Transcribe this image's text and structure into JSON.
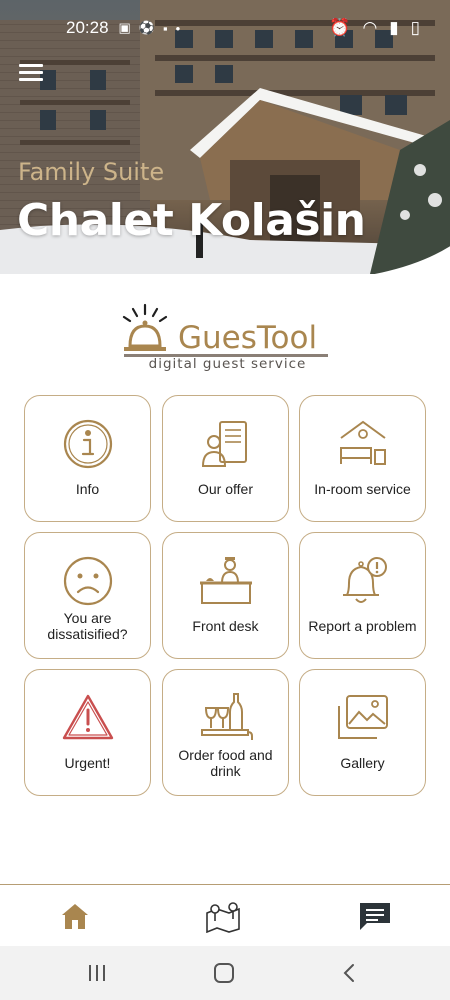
{
  "status_bar": {
    "time": "20:28"
  },
  "hero": {
    "subtitle": "Family Suite",
    "title": "Chalet Kolašin"
  },
  "logo": {
    "name": "GuesTool",
    "tagline": "digital guest service"
  },
  "tiles": [
    {
      "label": "Info",
      "icon": "info-icon"
    },
    {
      "label": "Our offer",
      "icon": "offer-icon"
    },
    {
      "label": "In-room service",
      "icon": "room-service-icon"
    },
    {
      "label": "You are dissatisified?",
      "icon": "sad-face-icon"
    },
    {
      "label": "Front desk",
      "icon": "front-desk-icon"
    },
    {
      "label": "Report a problem",
      "icon": "bell-alert-icon"
    },
    {
      "label": "Urgent!",
      "icon": "warning-icon"
    },
    {
      "label": "Order food and drink",
      "icon": "food-drink-icon"
    },
    {
      "label": "Gallery",
      "icon": "gallery-icon"
    }
  ],
  "bottom_nav": [
    "home-icon",
    "map-icon",
    "chat-icon"
  ],
  "colors": {
    "accent": "#a9864f",
    "border": "#c5ad86",
    "urgent": "#c94f4f"
  }
}
